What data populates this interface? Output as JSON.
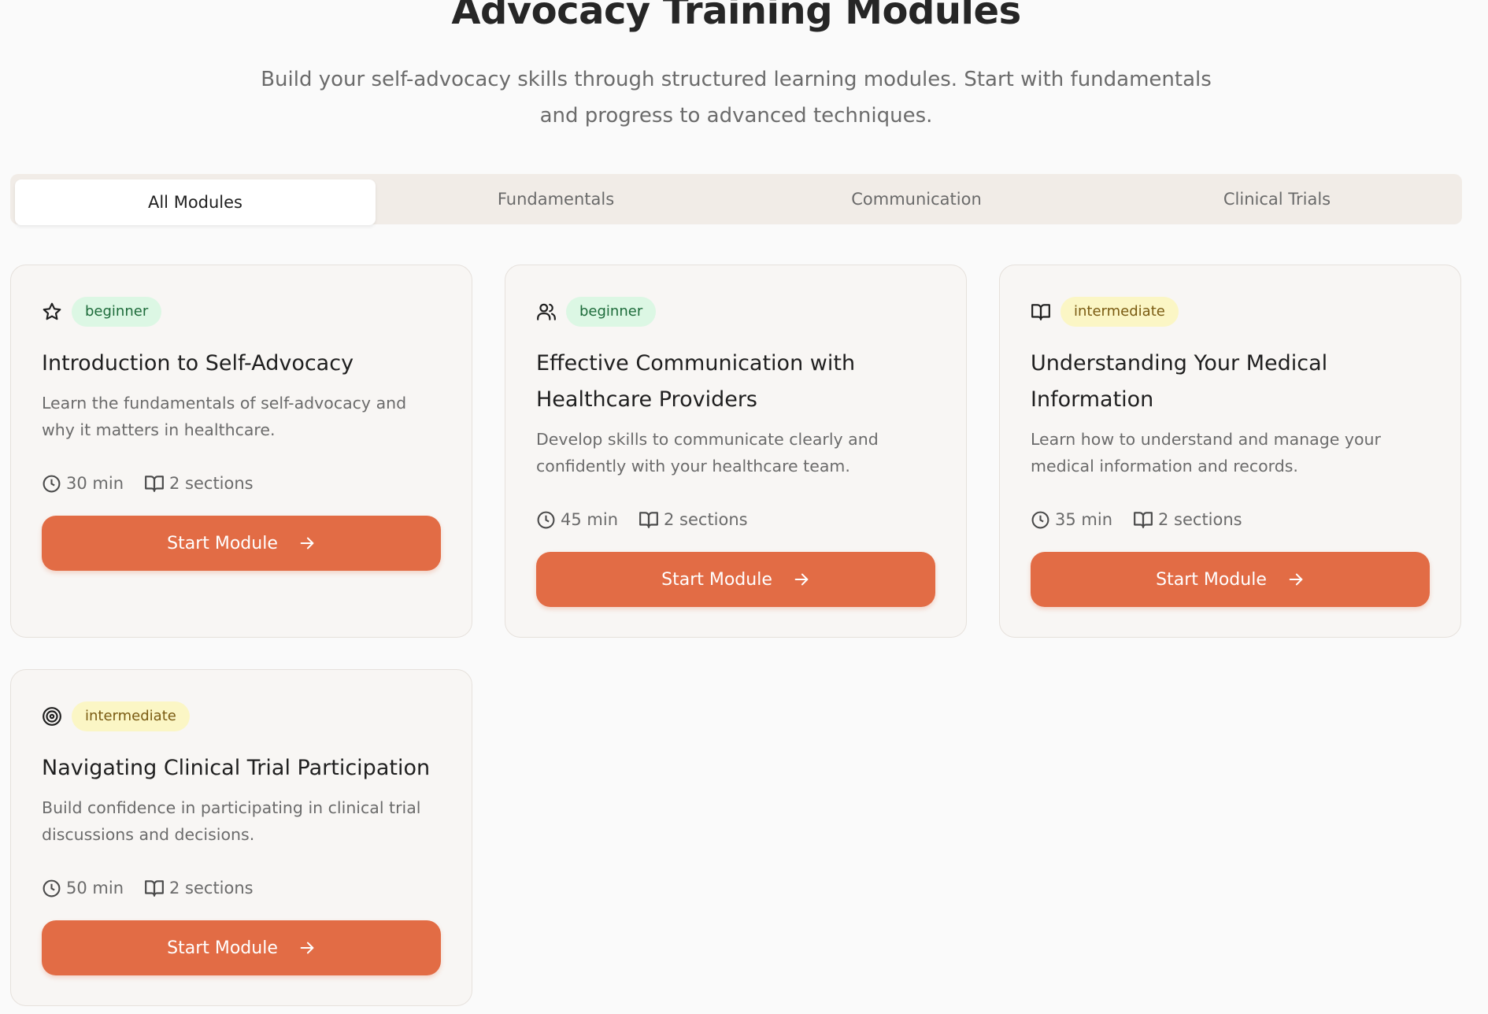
{
  "header": {
    "title": "Advocacy Training Modules",
    "subtitle": "Build your self-advocacy skills through structured learning modules. Start with fundamentals and progress to advanced techniques."
  },
  "tabs": [
    {
      "label": "All Modules",
      "active": true
    },
    {
      "label": "Fundamentals",
      "active": false
    },
    {
      "label": "Communication",
      "active": false
    },
    {
      "label": "Clinical Trials",
      "active": false
    }
  ],
  "modules": [
    {
      "icon": "star-icon",
      "level": "beginner",
      "title": "Introduction to Self-Advocacy",
      "description": "Learn the fundamentals of self-advocacy and why it matters in healthcare.",
      "duration": "30 min",
      "sections": "2 sections",
      "button_label": "Start Module"
    },
    {
      "icon": "users-icon",
      "level": "beginner",
      "title": "Effective Communication with Healthcare Providers",
      "description": "Develop skills to communicate clearly and confidently with your healthcare team.",
      "duration": "45 min",
      "sections": "2 sections",
      "button_label": "Start Module"
    },
    {
      "icon": "book-open-icon",
      "level": "intermediate",
      "title": "Understanding Your Medical Information",
      "description": "Learn how to understand and manage your medical information and records.",
      "duration": "35 min",
      "sections": "2 sections",
      "button_label": "Start Module"
    },
    {
      "icon": "target-icon",
      "level": "intermediate",
      "title": "Navigating Clinical Trial Participation",
      "description": "Build confidence in participating in clinical trial discussions and decisions.",
      "duration": "50 min",
      "sections": "2 sections",
      "button_label": "Start Module"
    }
  ],
  "colors": {
    "accent": "#e26c45",
    "beginner_bg": "#dcf7e4",
    "intermediate_bg": "#fbf6c5"
  }
}
